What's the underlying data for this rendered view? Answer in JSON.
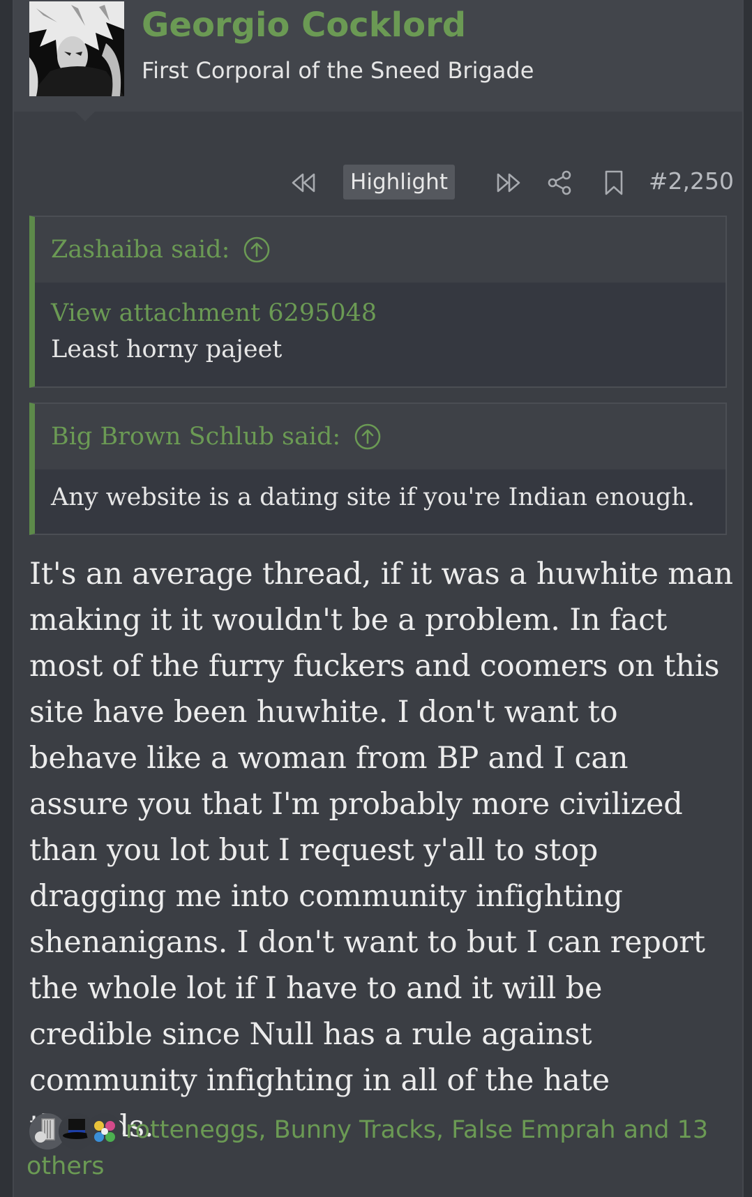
{
  "user": {
    "name": "Georgio Cocklord",
    "title": "First Corporal of the Sneed Brigade"
  },
  "actions": {
    "highlight_label": "Highlight",
    "post_number": "#2,250"
  },
  "quotes": [
    {
      "author_line": "Zashaiba said:",
      "attachment_link": "View attachment 6295048",
      "text": "Least horny pajeet"
    },
    {
      "author_line": "Big Brown Schlub said:",
      "text": "Any website is a dating site if you're Indian enough."
    }
  ],
  "message": {
    "text": "It's an average thread, if it was a huwhite man making it it wouldn't be a problem. In fact most of the furry fuckers and coomers on this site have been huwhite. I don't want to behave like a woman from BP and I can assure you that I'm probably more civilized than you lot but I request y'all to stop dragging me into community infighting shenanigans. I don't want to but I can report the whole lot if I have to and it will be credible since Null has a rule against community infighting in all of the hate threads."
  },
  "reactions": {
    "text": "rotteneggs, Bunny Tracks, False Emprah and 13 others"
  },
  "colors": {
    "accent_green": "#6b9a54",
    "background": "#3b3e44"
  }
}
